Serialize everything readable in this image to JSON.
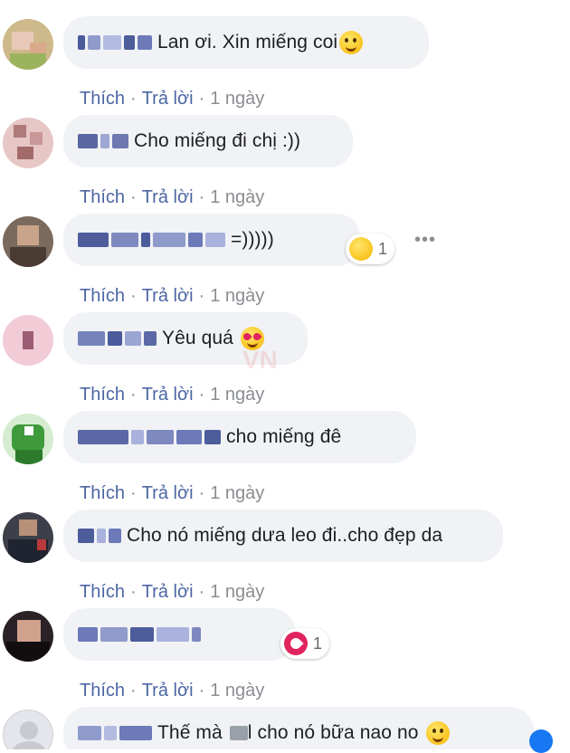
{
  "actions": {
    "like": "Thích",
    "reply": "Trả lời",
    "separator": "·"
  },
  "more_label": "•••",
  "watermark": "VN",
  "comments": [
    {
      "text": "Lan ơi. Xin miếng coi",
      "emoji": "rofl-emoji",
      "time": "1 ngày",
      "reaction": null
    },
    {
      "text": "Cho miếng đi chị :))",
      "time": "1 ngày",
      "reaction": null
    },
    {
      "text": "=)))))",
      "time": "1 ngày",
      "reaction": {
        "icon": "haha-reaction-icon",
        "count": "1"
      }
    },
    {
      "text": "Yêu quá",
      "emoji": "heart-eyes-emoji",
      "time": "1 ngày",
      "reaction": null
    },
    {
      "text": "cho miếng đê",
      "time": "1 ngày",
      "reaction": null
    },
    {
      "text": "Cho nó miếng dưa leo đi..cho đẹp da",
      "time": "1 ngày",
      "reaction": null
    },
    {
      "text": "",
      "time": "1 ngày",
      "reaction": {
        "icon": "love-reaction-icon",
        "count": "1"
      }
    },
    {
      "text": "Thế mà",
      "text2": "l cho nó bữa nao no",
      "emoji": "smile-emoji",
      "time": "",
      "reaction": null
    }
  ],
  "colors": {
    "bubble": "#f0f2f5",
    "link": "#4c66a4",
    "meta": "#8a8d91",
    "text": "#1c1e21"
  }
}
